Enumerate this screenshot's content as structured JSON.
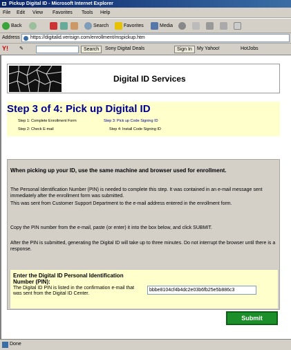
{
  "window": {
    "title": "Pickup Digital ID - Microsoft Internet Explorer"
  },
  "menu": [
    "File",
    "Edit",
    "View",
    "Favorites",
    "Tools",
    "Help"
  ],
  "toolbar": {
    "back": "Back",
    "search": "Search",
    "favorites": "Favorites",
    "media": "Media"
  },
  "address": {
    "label": "Address",
    "url": "https://digitalid.verisign.com/enrollment/mspickup.htm"
  },
  "yahoo": {
    "search_button": "Search",
    "sony": "Sony Digital Deals",
    "signin": "Sign In",
    "myyahoo": "My Yahoo!",
    "hotjobs": "HotJobs"
  },
  "page": {
    "brand": "Digital ID Services",
    "step_title": "Step 3 of 4: Pick up Digital ID",
    "steps": {
      "s1": "Step 1: Complete Enrollment Form",
      "s2": "Step 2: Check E-mail",
      "s3": "Step 3: Pick up Code Signing ID",
      "s4": "Step 4: Install Code Signing ID"
    },
    "heading": "When picking up your ID, use the same machine and browser used for enrollment.",
    "para1": "The Personal Identification Number (PIN) is needed to complete this step. It was contained in an e-mail message sent immediately after the enrollment form was submitted.",
    "para1b": "This was sent from               Customer Support Department to the e-mail address entered in the enrollment form.",
    "para2": "Copy the PIN number from the e-mail, paste (or enter) it into the box below, and click SUBMIT.",
    "para3": "After the PIN is submitted, generating the Digital ID will take up to three minutes. Do not interrupt the browser until there is a response.",
    "pin_title": "Enter the Digital ID Personal Identification Number (PIN):",
    "pin_desc": "The Digital ID PIN is listed in the confirmation e-mail that was sent from the Digital ID Center.",
    "pin_value": "bbbe8104cf4b4dc2e03b6fb25e5b886c3",
    "submit": "Submit"
  },
  "status": {
    "text": "Done"
  },
  "colors": {
    "title_blue": "#00008b",
    "step_panel": "#ffffcc",
    "submit_green": "#1d8f2a"
  }
}
